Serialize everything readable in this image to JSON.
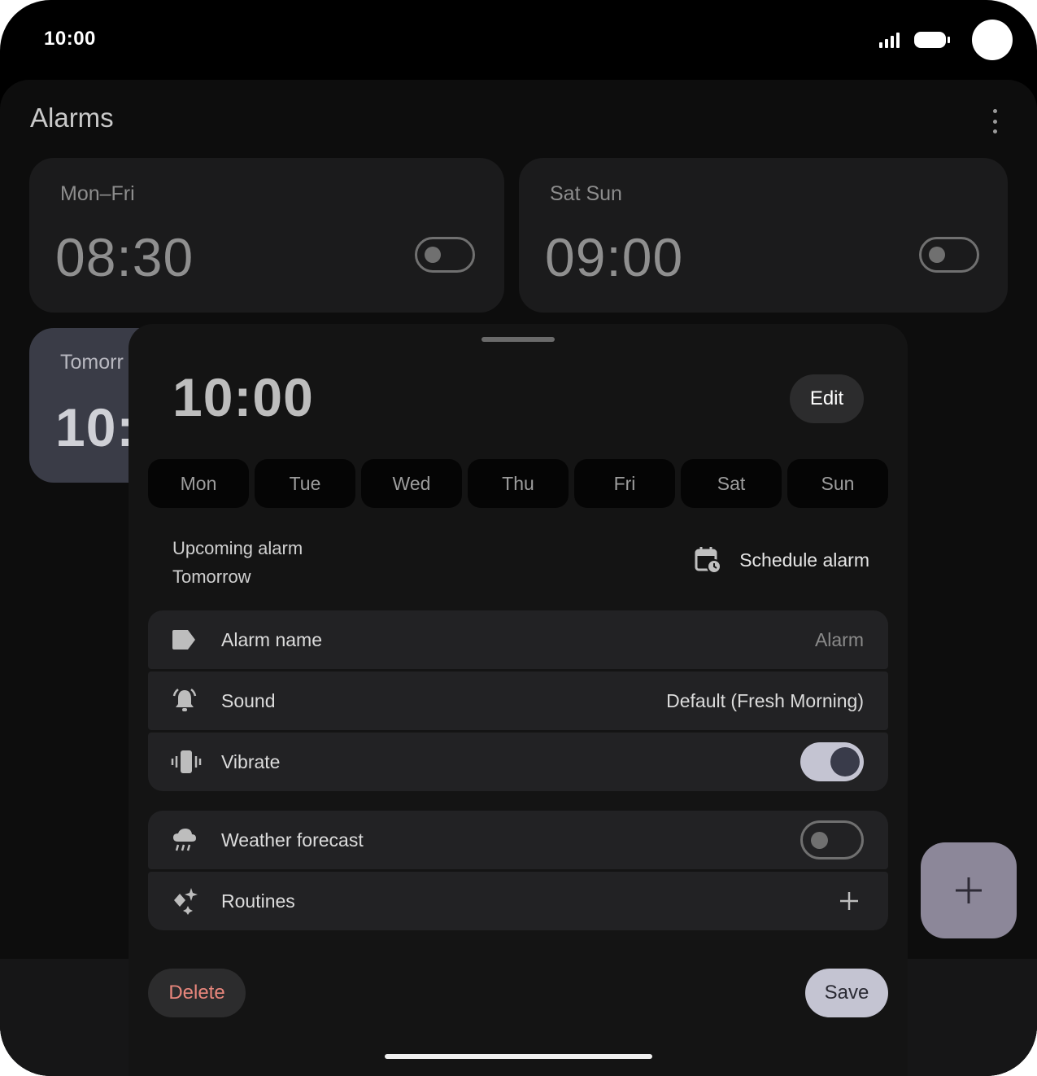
{
  "status_bar": {
    "time": "10:00"
  },
  "app": {
    "title": "Alarms"
  },
  "alarms": [
    {
      "days": "Mon–Fri",
      "time": "08:30",
      "enabled": false
    },
    {
      "days": "Sat Sun",
      "time": "09:00",
      "enabled": false
    },
    {
      "days": "Tomorr",
      "time": "10:"
    }
  ],
  "sheet": {
    "time": "10:00",
    "edit_label": "Edit",
    "days": [
      "Mon",
      "Tue",
      "Wed",
      "Thu",
      "Fri",
      "Sat",
      "Sun"
    ],
    "upcoming_label": "Upcoming alarm",
    "upcoming_when": "Tomorrow",
    "schedule_label": "Schedule alarm",
    "settings": {
      "alarm_name": {
        "label": "Alarm name",
        "value": "Alarm"
      },
      "sound": {
        "label": "Sound",
        "value": "Default (Fresh Morning)"
      },
      "vibrate": {
        "label": "Vibrate",
        "enabled": true
      },
      "weather": {
        "label": "Weather forecast",
        "enabled": false
      },
      "routines": {
        "label": "Routines"
      }
    },
    "delete_label": "Delete",
    "save_label": "Save"
  },
  "colors": {
    "accent": "#c4c4d2",
    "delete_text": "#e8867c",
    "fab": "#8c8799"
  },
  "icons": [
    "signal-icon",
    "battery-icon",
    "overflow-menu-icon",
    "calendar-clock-icon",
    "label-icon",
    "bell-icon",
    "vibrate-icon",
    "weather-icon",
    "sparkle-icon",
    "plus-icon"
  ]
}
